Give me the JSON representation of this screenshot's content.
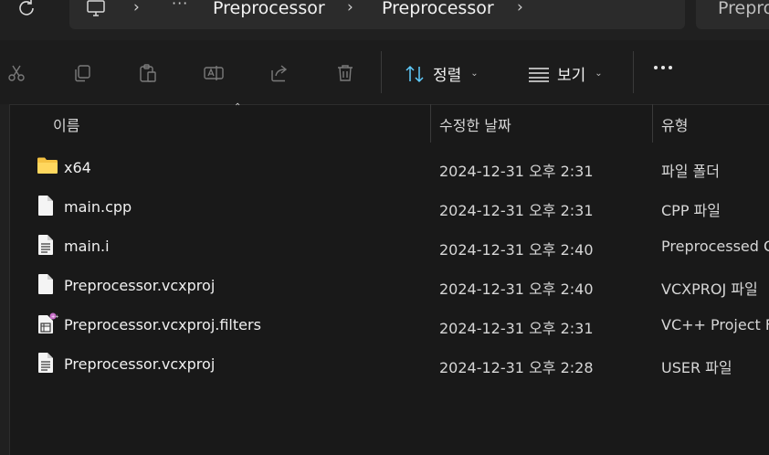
{
  "address": {
    "more": "···",
    "crumbs": [
      "Preprocessor",
      "Preprocessor"
    ],
    "search_partial": "Prepro"
  },
  "toolbar": {
    "sort_label": "정렬",
    "view_label": "보기"
  },
  "columns": {
    "name": "이름",
    "modified": "수정한 날짜",
    "type": "유형"
  },
  "files": [
    {
      "icon": "folder-icon",
      "name": "x64",
      "modified": "2024-12-31 오후 2:31",
      "type": "파일 폴더"
    },
    {
      "icon": "file-icon",
      "name": "main.cpp",
      "modified": "2024-12-31 오후 2:31",
      "type": "CPP 파일"
    },
    {
      "icon": "text-file-icon",
      "name": "main.i",
      "modified": "2024-12-31 오후 2:40",
      "type": "Preprocessed C"
    },
    {
      "icon": "file-icon",
      "name": "Preprocessor.vcxproj",
      "modified": "2024-12-31 오후 2:40",
      "type": "VCXPROJ 파일"
    },
    {
      "icon": "filters-file-icon",
      "name": "Preprocessor.vcxproj.filters",
      "modified": "2024-12-31 오후 2:31",
      "type": "VC++ Project F"
    },
    {
      "icon": "text-file-icon",
      "name": "Preprocessor.vcxproj",
      "modified": "2024-12-31 오후 2:28",
      "type": "USER 파일"
    }
  ]
}
